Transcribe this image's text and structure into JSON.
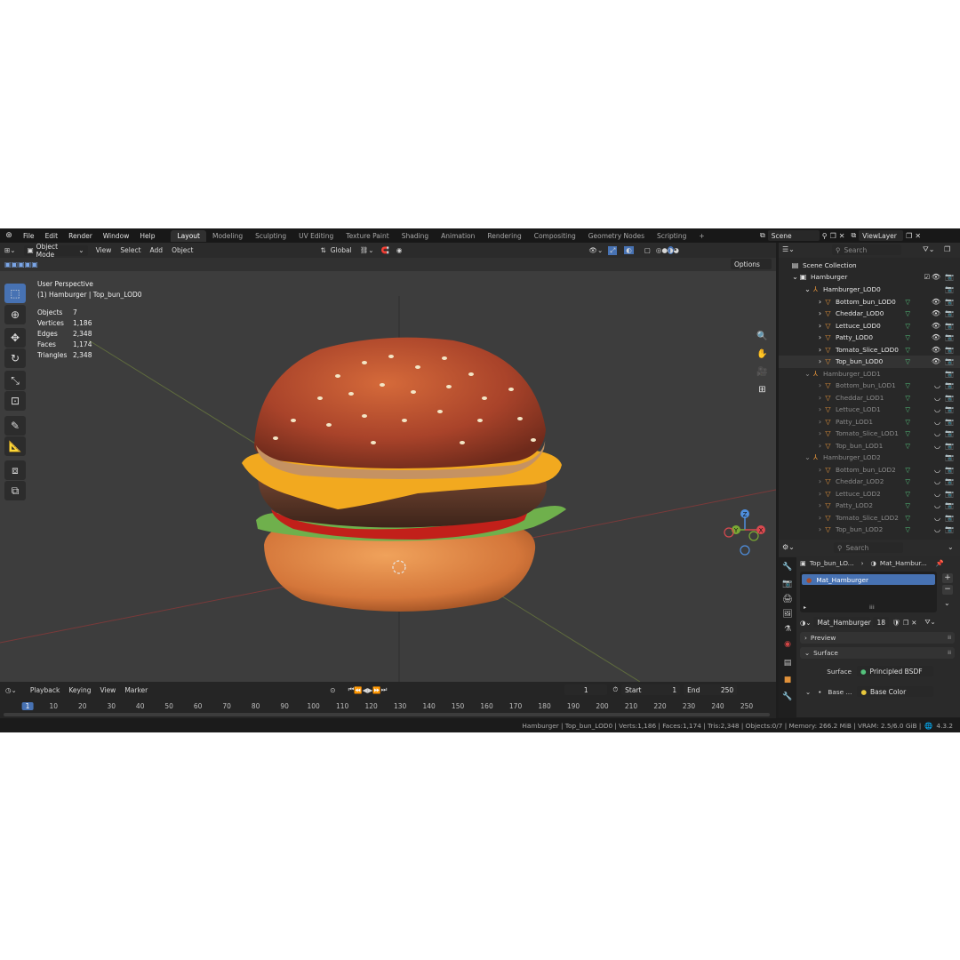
{
  "topbar": {
    "menus": [
      "File",
      "Edit",
      "Render",
      "Window",
      "Help"
    ],
    "workspaces": [
      "Layout",
      "Modeling",
      "Sculpting",
      "UV Editing",
      "Texture Paint",
      "Shading",
      "Animation",
      "Rendering",
      "Compositing",
      "Geometry Nodes",
      "Scripting"
    ],
    "active_workspace": "Layout",
    "add_tab": "+",
    "scene": "Scene",
    "view_layer": "ViewLayer"
  },
  "viewport": {
    "mode": "Object Mode",
    "menus": [
      "View",
      "Select",
      "Add",
      "Object"
    ],
    "orientation": "Global",
    "options": "Options",
    "view_name": "User Perspective",
    "context": "(1) Hamburger | Top_bun_LOD0",
    "stats": [
      {
        "label": "Objects",
        "value": "7"
      },
      {
        "label": "Vertices",
        "value": "1,186"
      },
      {
        "label": "Edges",
        "value": "2,348"
      },
      {
        "label": "Faces",
        "value": "1,174"
      },
      {
        "label": "Triangles",
        "value": "2,348"
      }
    ],
    "gizmo": {
      "z": "Z",
      "y": "Y",
      "x": "X"
    }
  },
  "outliner": {
    "search_placeholder": "Search",
    "root": "Scene Collection",
    "collection": "Hamburger",
    "groups": [
      {
        "name": "Hamburger_LOD0",
        "dim": false,
        "items": [
          "Bottom_bun_LOD0",
          "Cheddar_LOD0",
          "Lettuce_LOD0",
          "Patty_LOD0",
          "Tomato_Slice_LOD0",
          "Top_bun_LOD0"
        ]
      },
      {
        "name": "Hamburger_LOD1",
        "dim": true,
        "items": [
          "Bottom_bun_LOD1",
          "Cheddar_LOD1",
          "Lettuce_LOD1",
          "Patty_LOD1",
          "Tomato_Slice_LOD1",
          "Top_bun_LOD1"
        ]
      },
      {
        "name": "Hamburger_LOD2",
        "dim": true,
        "items": [
          "Bottom_bun_LOD2",
          "Cheddar_LOD2",
          "Lettuce_LOD2",
          "Patty_LOD2",
          "Tomato_Slice_LOD2",
          "Top_bun_LOD2"
        ]
      }
    ]
  },
  "properties": {
    "search_placeholder": "Search",
    "breadcrumb_object": "Top_bun_LO...",
    "breadcrumb_material": "Mat_Hambur...",
    "slot": "Mat_Hamburger",
    "material_name": "Mat_Hamburger",
    "users": "18",
    "preview": "Preview",
    "surface_header": "Surface",
    "surface_label": "Surface",
    "surface_value": "Principled BSDF",
    "base_label": "Base ...",
    "base_value": "Base Color"
  },
  "timeline": {
    "menus": [
      "Playback",
      "Keying",
      "View",
      "Marker"
    ],
    "current_frame": "1",
    "start_label": "Start",
    "start_value": "1",
    "end_label": "End",
    "end_value": "250",
    "ticks": [
      "1",
      "10",
      "20",
      "30",
      "40",
      "50",
      "60",
      "70",
      "80",
      "90",
      "100",
      "110",
      "120",
      "130",
      "140",
      "150",
      "160",
      "170",
      "180",
      "190",
      "200",
      "210",
      "220",
      "230",
      "240",
      "250"
    ]
  },
  "status": {
    "text": "Hamburger | Top_bun_LOD0 | Verts:1,186 | Faces:1,174 | Tris:2,348 | Objects:0/7 | Memory: 266.2 MiB | VRAM: 2.5/6.0 GiB |",
    "version": "4.3.2"
  },
  "colors": {
    "accent": "#4772b3",
    "orange_mesh": "#e0913a",
    "mesh_green": "#54c27c"
  }
}
